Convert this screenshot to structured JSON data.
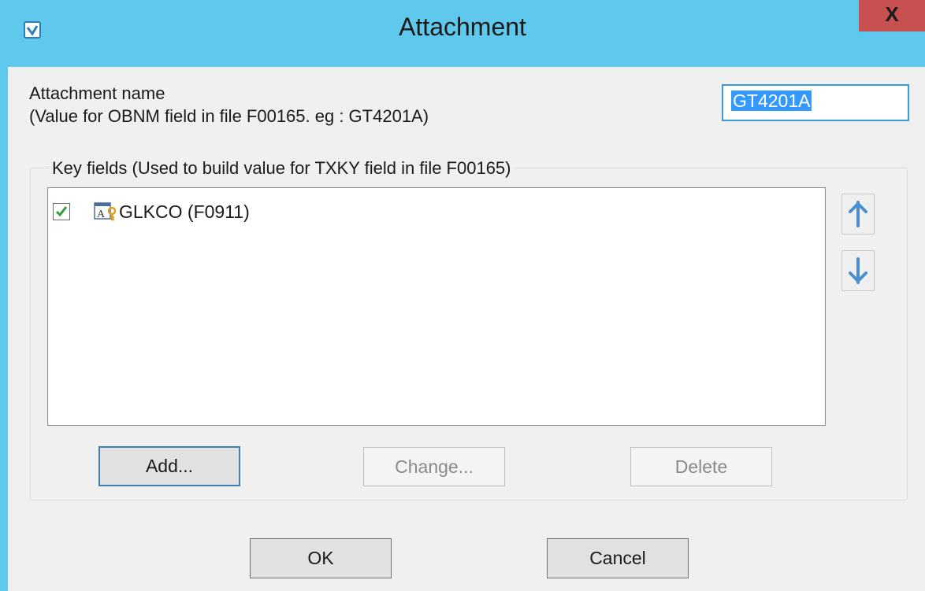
{
  "window": {
    "title": "Attachment",
    "close_label": "X"
  },
  "attachment": {
    "label_line1": "Attachment name",
    "label_line2": "(Value for OBNM field in file F00165. eg : GT4201A)",
    "value": "GT4201A"
  },
  "key_fields": {
    "legend": "Key fields (Used to build value for TXKY field in file F00165)",
    "items": [
      {
        "label": "GLKCO (F0911)",
        "checked": true,
        "icon": "key-field-icon"
      }
    ]
  },
  "buttons": {
    "add": "Add...",
    "change": "Change...",
    "delete": "Delete",
    "ok": "OK",
    "cancel": "Cancel"
  },
  "colors": {
    "titlebar": "#5ec9ec",
    "close": "#c75050",
    "selection": "#3399ff",
    "check": "#2e9e3a",
    "arrow": "#4a8fd0"
  }
}
